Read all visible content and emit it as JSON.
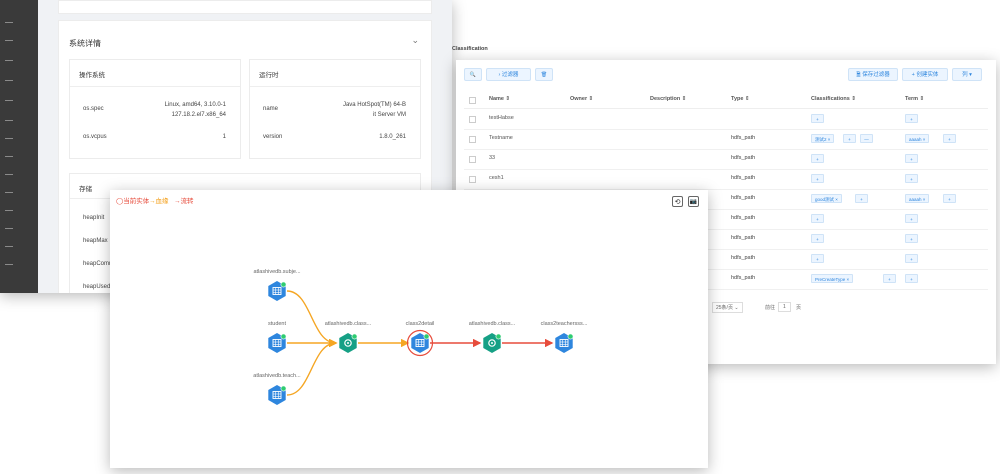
{
  "detail_window": {
    "section_title": "系统详情",
    "os_card": {
      "title": "操作系统",
      "rows": [
        {
          "key": "os.spec",
          "value_line1": "Linux, amd64, 3.10.0-1",
          "value_line2": "127.18.2.el7.x86_64"
        },
        {
          "key": "os.vcpus",
          "value_line1": "1",
          "value_line2": ""
        }
      ]
    },
    "runtime_card": {
      "title": "运行时",
      "rows": [
        {
          "key": "name",
          "value_line1": "Java HotSpot(TM) 64-B",
          "value_line2": "it Server VM"
        },
        {
          "key": "version",
          "value_line1": "1.8.0_261",
          "value_line2": ""
        }
      ]
    },
    "storage_card": {
      "title": "存储",
      "items": [
        "heapInit",
        "heapMax",
        "heapComm",
        "heapUsed"
      ]
    }
  },
  "table_window": {
    "peek_text": "Classification",
    "toolbar": {
      "search_icon": "🔍",
      "filter_label": "过滤器",
      "filter_icon": "›",
      "delete_icon": "🗑",
      "save_filter_label": "保存过滤器",
      "save_filter_icon": "🗎",
      "create_entity_label": "创建实体",
      "create_entity_icon": "+",
      "columns_label": "列",
      "columns_icon": "▾"
    },
    "columns": [
      "Name ⇕",
      "Owner ⇕",
      "Description ⇕",
      "Type ⇕",
      "Classifications ⇕",
      "Term ⇕"
    ],
    "rows": [
      {
        "name": "testHabse",
        "type": "",
        "tags": [],
        "class_add": true,
        "terms": [],
        "term_add": true
      },
      {
        "name": "Testname",
        "type": "hdfs_path",
        "tags": [
          "测试2"
        ],
        "class_add": true,
        "class_more": true,
        "terms": [
          "aaaah"
        ],
        "term_add": true
      },
      {
        "name": "33",
        "type": "hdfs_path",
        "tags": [],
        "class_add": true,
        "terms": [],
        "term_add": true
      },
      {
        "name": "cesh1",
        "type": "hdfs_path",
        "tags": [],
        "class_add": true,
        "terms": [],
        "term_add": true
      },
      {
        "name": "",
        "type": "hdfs_path",
        "tags": [
          "good测试"
        ],
        "class_add": true,
        "terms": [
          "aaaah"
        ],
        "term_add": true
      },
      {
        "name": "",
        "type": "hdfs_path",
        "tags": [],
        "class_add": true,
        "terms": [],
        "term_add": true
      },
      {
        "name": "",
        "type": "hdfs_path",
        "tags": [],
        "class_add": true,
        "terms": [],
        "term_add": true
      },
      {
        "name": "",
        "type": "hdfs_path",
        "tags": [],
        "class_add": true,
        "terms": [],
        "term_add": true
      },
      {
        "name": "",
        "type": "hdfs_path",
        "tags": [
          "PreCreateType"
        ],
        "class_add": true,
        "terms": [],
        "term_add": true
      }
    ],
    "tag_close": "×",
    "class_add_symbol": "+",
    "class_more_symbol": "—",
    "pagination": {
      "page_size": "25条/页",
      "goto_label": "前往",
      "page_value": "1",
      "page_unit": "页"
    }
  },
  "lineage_window": {
    "legend": [
      {
        "symbol": "◯",
        "label": "当前实体",
        "color": "#e74c3c"
      },
      {
        "symbol": "→",
        "label": "血缘",
        "color": "#f39c12"
      },
      {
        "symbol": "→",
        "label": "流转",
        "color": "#e74c3c"
      }
    ],
    "tool_icons": {
      "refresh": "⟲",
      "camera": "📷"
    },
    "colors": {
      "table_node": "#2e86de",
      "process_node": "#16a085",
      "lineage_edge": "#f5a623",
      "flow_edge": "#e74c3c"
    },
    "nodes": [
      {
        "id": "n1",
        "label": "atlashivedb.subje...",
        "kind": "table"
      },
      {
        "id": "n2",
        "label": "student",
        "kind": "table"
      },
      {
        "id": "n3",
        "label": "atlashivedb.teach...",
        "kind": "table"
      },
      {
        "id": "n4",
        "label": "atlashivedb.class...",
        "kind": "process"
      },
      {
        "id": "n5",
        "label": "class2detail",
        "kind": "table",
        "current": true
      },
      {
        "id": "n6",
        "label": "atlashivedb.class...",
        "kind": "process"
      },
      {
        "id": "n7",
        "label": "class2teachersss...",
        "kind": "table"
      }
    ],
    "edges": [
      {
        "from": "n1",
        "to": "n4",
        "kind": "lineage"
      },
      {
        "from": "n2",
        "to": "n4",
        "kind": "lineage"
      },
      {
        "from": "n3",
        "to": "n4",
        "kind": "lineage"
      },
      {
        "from": "n4",
        "to": "n5",
        "kind": "lineage"
      },
      {
        "from": "n5",
        "to": "n6",
        "kind": "flow"
      },
      {
        "from": "n6",
        "to": "n7",
        "kind": "flow"
      }
    ]
  }
}
